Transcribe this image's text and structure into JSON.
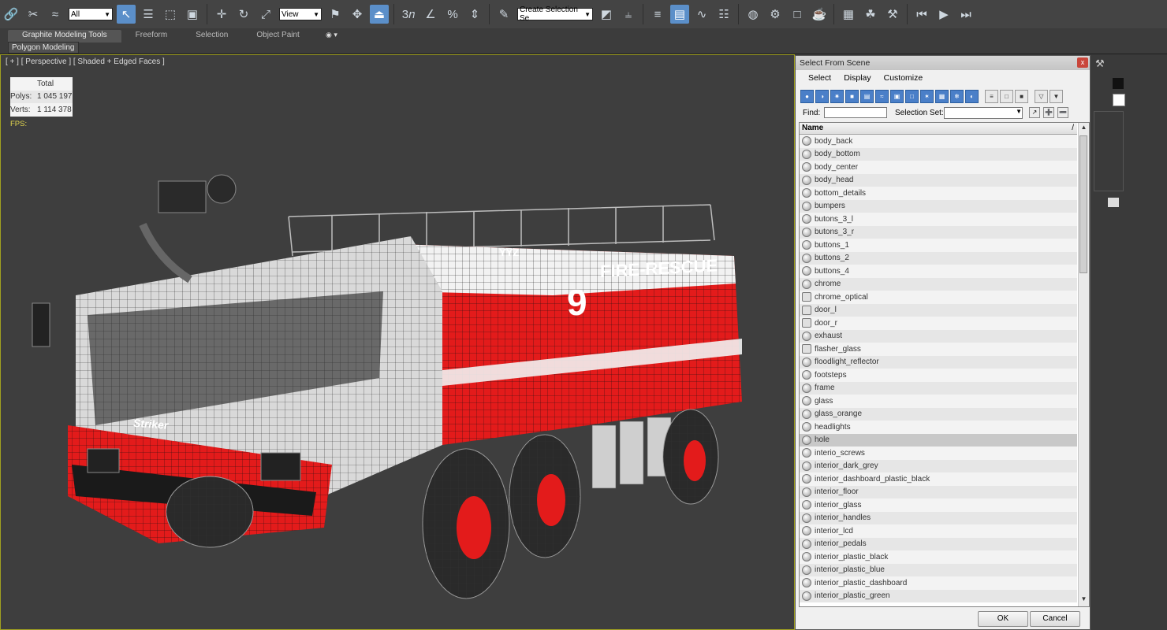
{
  "toolbar": {
    "filter_value": "All",
    "ref_coord_value": "View",
    "selection_set_placeholder": "Create Selection Se",
    "snap_angle_label": "3",
    "snap_percent_label": "%"
  },
  "ribbon": {
    "tabs": [
      "Graphite Modeling Tools",
      "Freeform",
      "Selection",
      "Object Paint"
    ],
    "panel_label": "Polygon Modeling",
    "more_label": "◉ ▾"
  },
  "viewport": {
    "label": "[ + ] [ Perspective ] [ Shaded + Edged Faces ]",
    "stats_header": "Total",
    "polys_label": "Polys:",
    "polys_value": "1 045 197",
    "verts_label": "Verts:",
    "verts_value": "1 114 378",
    "fps_label": "FPS:",
    "truck_number": "9",
    "truck_text": "FIRE-RESCUE",
    "truck_logo": "Striker",
    "truck_tag": "YYZ"
  },
  "dialog": {
    "title": "Select From Scene",
    "close_label": "x",
    "menu": [
      "Select",
      "Display",
      "Customize"
    ],
    "find_label": "Find:",
    "find_value": "",
    "selection_set_label": "Selection Set:",
    "list_header": "Name",
    "sort_indicator": "/",
    "items": [
      {
        "name": "body_back",
        "icon": "sphere-icon"
      },
      {
        "name": "body_bottom",
        "icon": "sphere-icon"
      },
      {
        "name": "body_center",
        "icon": "sphere-icon"
      },
      {
        "name": "body_head",
        "icon": "sphere-icon"
      },
      {
        "name": "bottom_details",
        "icon": "sphere-icon"
      },
      {
        "name": "bumpers",
        "icon": "sphere-icon"
      },
      {
        "name": "butons_3_l",
        "icon": "sphere-icon"
      },
      {
        "name": "butons_3_r",
        "icon": "sphere-icon"
      },
      {
        "name": "buttons_1",
        "icon": "sphere-icon"
      },
      {
        "name": "buttons_2",
        "icon": "sphere-icon"
      },
      {
        "name": "buttons_4",
        "icon": "sphere-icon"
      },
      {
        "name": "chrome",
        "icon": "sphere-icon"
      },
      {
        "name": "chrome_optical",
        "icon": "helper-icon"
      },
      {
        "name": "door_l",
        "icon": "helper-icon"
      },
      {
        "name": "door_r",
        "icon": "helper-icon"
      },
      {
        "name": "exhaust",
        "icon": "sphere-icon"
      },
      {
        "name": "flasher_glass",
        "icon": "helper-icon"
      },
      {
        "name": "floodlight_reflector",
        "icon": "sphere-icon"
      },
      {
        "name": "footsteps",
        "icon": "sphere-icon"
      },
      {
        "name": "frame",
        "icon": "sphere-icon"
      },
      {
        "name": "glass",
        "icon": "sphere-icon"
      },
      {
        "name": "glass_orange",
        "icon": "sphere-icon"
      },
      {
        "name": "headlights",
        "icon": "sphere-icon"
      },
      {
        "name": "hole",
        "icon": "sphere-icon"
      },
      {
        "name": "interio_screws",
        "icon": "sphere-icon"
      },
      {
        "name": "interior_dark_grey",
        "icon": "sphere-icon"
      },
      {
        "name": "interior_dashboard_plastic_black",
        "icon": "sphere-icon"
      },
      {
        "name": "interior_floor",
        "icon": "sphere-icon"
      },
      {
        "name": "interior_glass",
        "icon": "sphere-icon"
      },
      {
        "name": "interior_handles",
        "icon": "sphere-icon"
      },
      {
        "name": "interior_lcd",
        "icon": "sphere-icon"
      },
      {
        "name": "interior_pedals",
        "icon": "sphere-icon"
      },
      {
        "name": "interior_plastic_black",
        "icon": "sphere-icon"
      },
      {
        "name": "interior_plastic_blue",
        "icon": "sphere-icon"
      },
      {
        "name": "interior_plastic_dashboard",
        "icon": "sphere-icon"
      },
      {
        "name": "interior_plastic_green",
        "icon": "sphere-icon"
      }
    ],
    "selected_item": "hole",
    "ok_label": "OK",
    "cancel_label": "Cancel"
  },
  "colors": {
    "accent": "#5b8fc9",
    "truck_red": "#e31b1b",
    "stats_yellow": "#e6d94f",
    "viewport_border": "#a0a020"
  }
}
